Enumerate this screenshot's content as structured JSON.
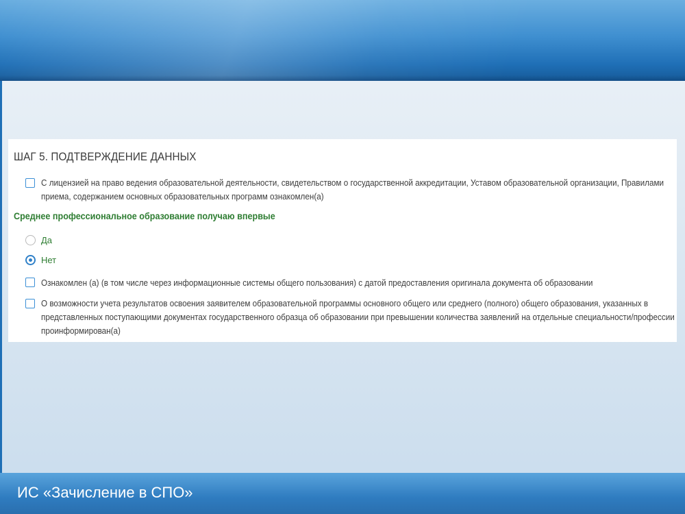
{
  "form": {
    "step_title": "ШАГ 5. ПОДТВЕРЖДЕНИЕ ДАННЫХ",
    "license_ack": "С лицензией на право ведения образовательной деятельности, свидетельством о государственной аккредитации, Уставом образовательной организации, Правилами приема, содержанием основных образовательных программ ознакомлен(а)",
    "spo_first": {
      "title": "Среднее профессиональное образование получаю впервые",
      "options": [
        "Да",
        "Нет"
      ],
      "selected": "Нет"
    },
    "original_date_ack": "Ознакомлен (а) (в том числе через информационные системы общего пользования) с датой предоставления оригинала документа об образовании",
    "results_ack": "О возможности учета результатов освоения заявителем образовательной программы основного общего или среднего (полного) общего образования, указанных в представленных поступающими документах государственного образца об образовании при превышении количества заявлений на отдельные специальности/профессии проинформирован(а)"
  },
  "footer": {
    "title": "ИС «Зачисление в СПО»"
  },
  "colors": {
    "accent_blue": "#2f80c8",
    "section_green": "#2e7d32"
  }
}
